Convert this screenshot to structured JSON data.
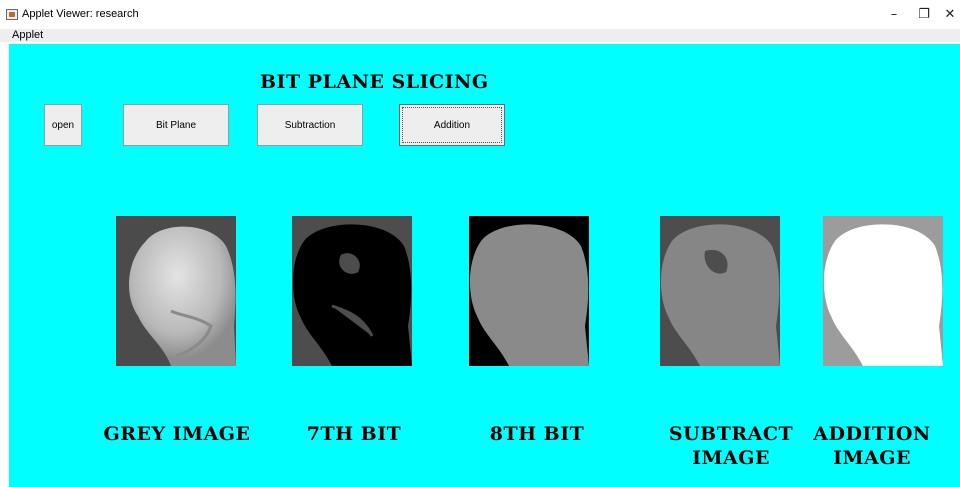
{
  "window": {
    "title": "Applet Viewer: research",
    "minimize_glyph": "–",
    "maximize_glyph": "❐",
    "close_glyph": "✕"
  },
  "menu": {
    "items": [
      "Applet"
    ]
  },
  "heading": "BIT PLANE SLICING",
  "buttons": {
    "open": "open",
    "bit_plane": "Bit Plane",
    "subtraction": "Subtraction",
    "addition": "Addition"
  },
  "images": [
    {
      "id": "grey",
      "background": "#4b4b4b",
      "fill": "#c8c8c8"
    },
    {
      "id": "bit7",
      "background": "#4d4d4d",
      "fill": "#000000"
    },
    {
      "id": "bit8",
      "background": "#000000",
      "fill": "#8a8a8a"
    },
    {
      "id": "subtract",
      "background": "#4d4d4d",
      "fill": "#868686"
    },
    {
      "id": "addition",
      "background": "#9c9c9c",
      "fill": "#ffffff"
    }
  ],
  "captions": {
    "grey": [
      "GREY IMAGE"
    ],
    "bit7": [
      "7TH BIT"
    ],
    "bit8": [
      "8TH BIT"
    ],
    "subtract": [
      "SUBTRACT",
      "IMAGE"
    ],
    "addition": [
      "ADDITION",
      "IMAGE"
    ]
  },
  "icons": {
    "app": "java-applet-icon",
    "minimize": "minimize-icon",
    "maximize": "maximize-icon",
    "close": "close-icon"
  }
}
